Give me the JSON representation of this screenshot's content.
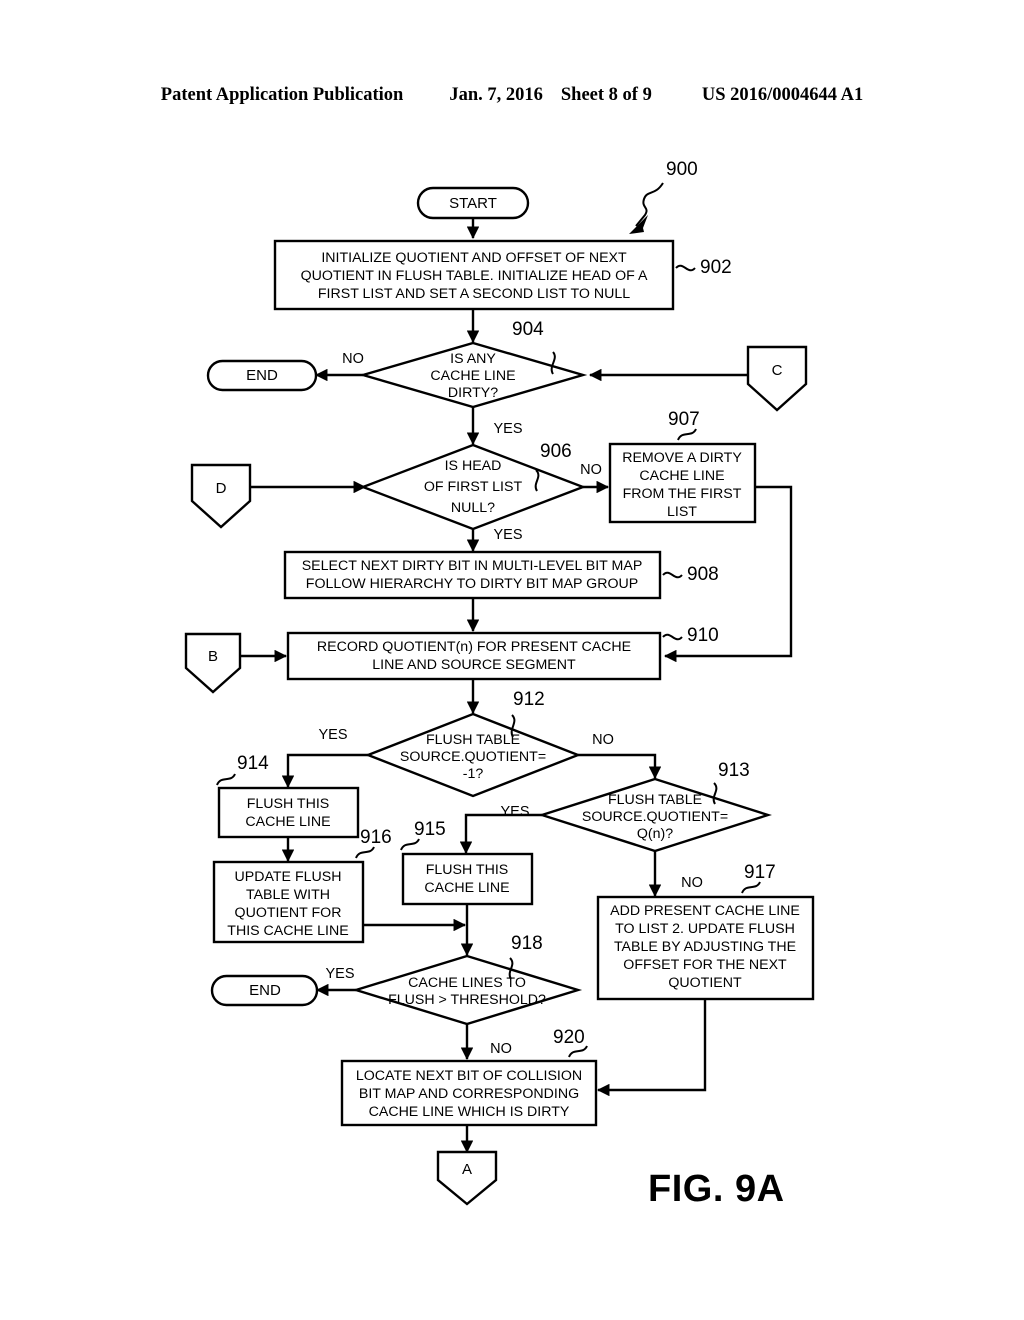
{
  "header": {
    "publication": "Patent Application Publication",
    "date": "Jan. 7, 2016",
    "sheet": "Sheet 8 of 9",
    "pubnumber": "US 2016/0004644 A1"
  },
  "figure": {
    "label": "FIG. 9A",
    "diagram_ref": "900"
  },
  "nodes": {
    "start": {
      "text": "START",
      "ref": ""
    },
    "n902": {
      "text": "INITIALIZE QUOTIENT AND OFFSET OF NEXT\nQUOTIENT IN FLUSH TABLE. INITIALIZE HEAD OF A\nFIRST LIST AND SET A SECOND LIST TO NULL",
      "ref": "902"
    },
    "n904": {
      "text": "IS ANY\nCACHE LINE\nDIRTY?",
      "ref": "904"
    },
    "end1": {
      "text": "END",
      "ref": ""
    },
    "connC": {
      "text": "C",
      "ref": ""
    },
    "n906": {
      "text": "IS HEAD\nOF FIRST LIST\nNULL?",
      "ref": "906"
    },
    "connD": {
      "text": "D",
      "ref": ""
    },
    "n907": {
      "text": "REMOVE A DIRTY\nCACHE LINE\nFROM THE FIRST\nLIST",
      "ref": "907"
    },
    "n908": {
      "text": "SELECT NEXT DIRTY BIT IN MULTI-LEVEL BIT MAP\nFOLLOW HIERARCHY TO DIRTY BIT MAP GROUP",
      "ref": "908"
    },
    "n910": {
      "text": "RECORD QUOTIENT(n) FOR PRESENT CACHE\nLINE AND SOURCE SEGMENT",
      "ref": "910"
    },
    "connB": {
      "text": "B",
      "ref": ""
    },
    "n912": {
      "text": "FLUSH TABLE\nSOURCE.QUOTIENT=\n-1?",
      "ref": "912"
    },
    "n913": {
      "text": "FLUSH TABLE\nSOURCE.QUOTIENT=\nQ(n)?",
      "ref": "913"
    },
    "n914": {
      "text": "FLUSH THIS\nCACHE LINE",
      "ref": "914"
    },
    "n915": {
      "text": "FLUSH THIS\nCACHE LINE",
      "ref": "915"
    },
    "n916": {
      "text": "UPDATE FLUSH\nTABLE WITH\nQUOTIENT FOR\nTHIS CACHE LINE",
      "ref": "916"
    },
    "n917": {
      "text": "ADD PRESENT CACHE LINE\nTO LIST 2. UPDATE FLUSH\nTABLE BY ADJUSTING THE\nOFFSET FOR THE NEXT\nQUOTIENT",
      "ref": "917"
    },
    "n918": {
      "text": "CACHE LINES TO\nFLUSH > THRESHOLD?",
      "ref": "918"
    },
    "end2": {
      "text": "END",
      "ref": ""
    },
    "n920": {
      "text": "LOCATE NEXT BIT OF COLLISION\nBIT MAP AND CORRESPONDING\nCACHE LINE WHICH IS DIRTY",
      "ref": "920"
    },
    "connA": {
      "text": "A",
      "ref": ""
    }
  },
  "edge_labels": {
    "e904_no": "NO",
    "e904_yes": "YES",
    "e906_no": "NO",
    "e906_yes": "YES",
    "e912_yes": "YES",
    "e912_no": "NO",
    "e913_yes": "YES",
    "e913_no": "NO",
    "e918_yes": "YES",
    "e918_no": "NO"
  },
  "colors": {
    "stroke": "#000000",
    "fill": "#ffffff",
    "text": "#000000"
  }
}
